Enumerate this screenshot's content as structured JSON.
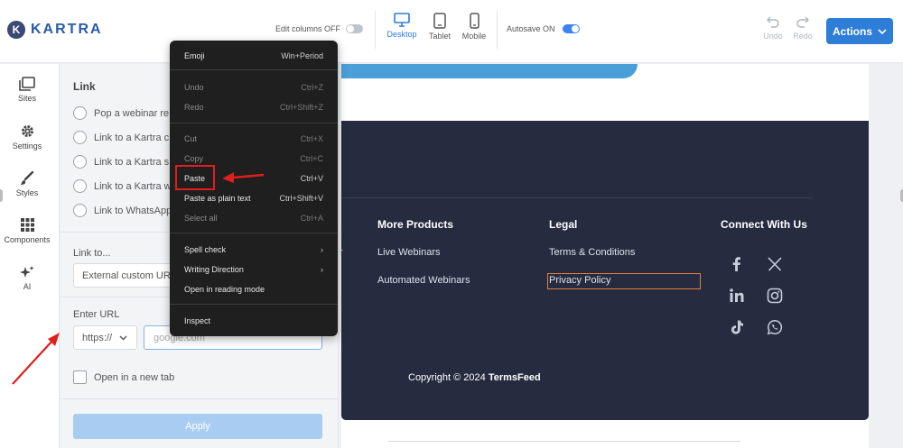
{
  "brand": {
    "name": "KARTRA",
    "mark": "K"
  },
  "topbar": {
    "edit_columns_label": "Edit columns OFF",
    "devices": [
      {
        "label": "Desktop",
        "icon": "desktop-icon",
        "active": true
      },
      {
        "label": "Tablet",
        "icon": "tablet-icon",
        "active": false
      },
      {
        "label": "Mobile",
        "icon": "mobile-icon",
        "active": false
      }
    ],
    "autosave_label": "Autosave ON",
    "undo_label": "Undo",
    "redo_label": "Redo",
    "actions_label": "Actions"
  },
  "sidebar": {
    "items": [
      {
        "label": "Sites",
        "icon": "sites-icon"
      },
      {
        "label": "Settings",
        "icon": "gear-icon"
      },
      {
        "label": "Styles",
        "icon": "brush-icon"
      },
      {
        "label": "Components",
        "icon": "grid-icon"
      },
      {
        "label": "AI",
        "icon": "sparkle-icon"
      }
    ]
  },
  "panel": {
    "title": "Link",
    "options": [
      "Pop a webinar re",
      "Link to a Kartra c",
      "Link to a Kartra s",
      "Link to a Kartra w",
      "Link to WhatsApp"
    ],
    "link_to_label": "Link to...",
    "link_to_value": "External custom URL",
    "enter_url_label": "Enter URL",
    "protocol_value": "https://",
    "url_placeholder": "google.com",
    "new_tab_label": "Open in a new tab",
    "apply_label": "Apply"
  },
  "context_menu": {
    "items": [
      {
        "label": "Emoji",
        "shortcut": "Win+Period",
        "disabled": false
      },
      {
        "label": "Undo",
        "shortcut": "Ctrl+Z",
        "disabled": true
      },
      {
        "label": "Redo",
        "shortcut": "Ctrl+Shift+Z",
        "disabled": true
      },
      {
        "label": "Cut",
        "shortcut": "Ctrl+X",
        "disabled": true
      },
      {
        "label": "Copy",
        "shortcut": "Ctrl+C",
        "disabled": true
      },
      {
        "label": "Paste",
        "shortcut": "Ctrl+V",
        "disabled": false
      },
      {
        "label": "Paste as plain text",
        "shortcut": "Ctrl+Shift+V",
        "disabled": false
      },
      {
        "label": "Select all",
        "shortcut": "Ctrl+A",
        "disabled": true
      },
      {
        "label": "Spell check",
        "shortcut": "›",
        "disabled": false
      },
      {
        "label": "Writing Direction",
        "shortcut": "›",
        "disabled": false
      },
      {
        "label": "Open in reading mode",
        "shortcut": "",
        "disabled": false
      },
      {
        "label": "Inspect",
        "shortcut": "",
        "disabled": false
      }
    ]
  },
  "footer": {
    "partial_text": "r",
    "columns": [
      {
        "heading": "More Products",
        "links": [
          "Live Webinars",
          "Automated Webinars"
        ]
      },
      {
        "heading": "Legal",
        "links": [
          "Terms & Conditions",
          "Privacy Policy"
        ]
      },
      {
        "heading": "Connect With Us",
        "links": []
      }
    ],
    "copyright_prefix": "Copyright © 2024 ",
    "copyright_brand": "TermsFeed"
  },
  "colors": {
    "accent": "#2e7dd6",
    "footer_bg": "#262b40",
    "annotation": "#e01e1e",
    "highlight": "#e0803a"
  }
}
